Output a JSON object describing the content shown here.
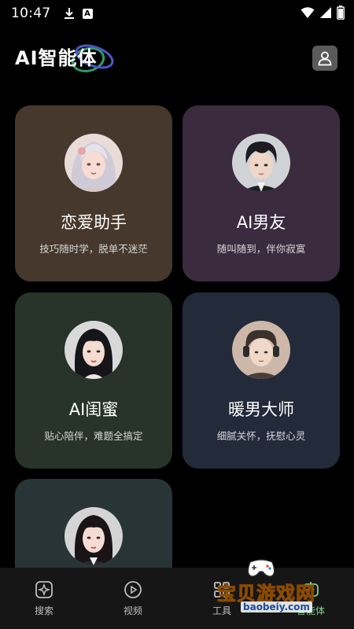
{
  "status_bar": {
    "time": "10:47",
    "badge": "A"
  },
  "header": {
    "title": "AI智能体"
  },
  "cards": [
    {
      "title": "恋爱助手",
      "desc": "技巧随时学，脱单不迷茫",
      "bg": "#46382c"
    },
    {
      "title": "AI男友",
      "desc": "随叫随到，伴你寂寞",
      "bg": "#3a2b3f"
    },
    {
      "title": "AI闺蜜",
      "desc": "贴心陪伴，难题全搞定",
      "bg": "#283329"
    },
    {
      "title": "暖男大师",
      "desc": "细腻关怀，抚慰心灵",
      "bg": "#232a3a"
    },
    {
      "title": "",
      "desc": "",
      "bg": "#293436"
    }
  ],
  "bottom_nav": [
    {
      "label": "搜索",
      "icon": "search-sparkle-icon"
    },
    {
      "label": "视频",
      "icon": "play-circle-icon"
    },
    {
      "label": "工具",
      "icon": "tools-icon"
    },
    {
      "label": "智能体",
      "icon": "agent-icon",
      "active": true
    }
  ],
  "watermark": {
    "text": "宝贝游戏网",
    "url": "baobeiy.com"
  }
}
